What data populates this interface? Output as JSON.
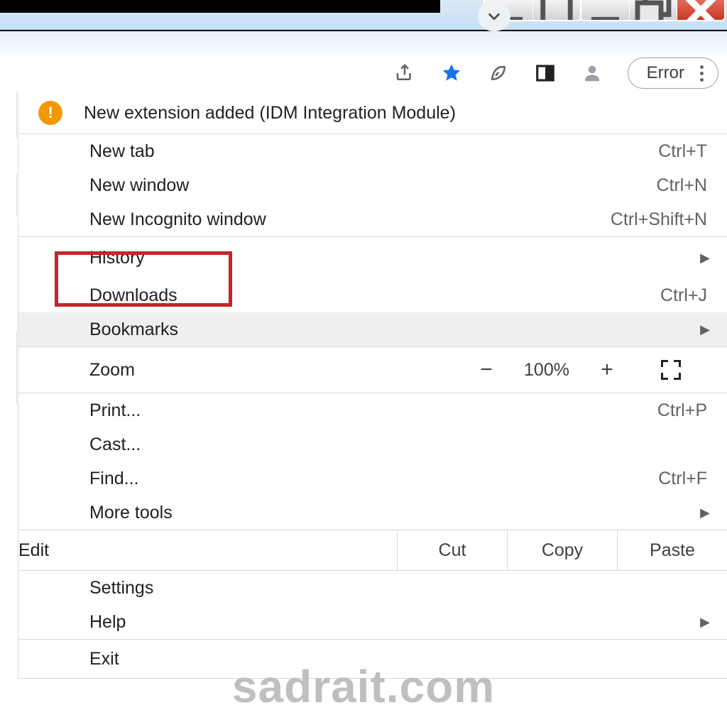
{
  "toolbar": {
    "error_label": "Error"
  },
  "notice": {
    "text": "New extension added (IDM Integration Module)"
  },
  "menu": {
    "new_tab": {
      "label": "New tab",
      "shortcut": "Ctrl+T"
    },
    "new_window": {
      "label": "New window",
      "shortcut": "Ctrl+N"
    },
    "new_incognito": {
      "label": "New Incognito window",
      "shortcut": "Ctrl+Shift+N"
    },
    "history": {
      "label": "History"
    },
    "downloads": {
      "label": "Downloads",
      "shortcut": "Ctrl+J"
    },
    "bookmarks": {
      "label": "Bookmarks"
    },
    "zoom": {
      "label": "Zoom",
      "value": "100%",
      "minus": "−",
      "plus": "+"
    },
    "print": {
      "label": "Print...",
      "shortcut": "Ctrl+P"
    },
    "cast": {
      "label": "Cast..."
    },
    "find": {
      "label": "Find...",
      "shortcut": "Ctrl+F"
    },
    "more_tools": {
      "label": "More tools"
    },
    "edit": {
      "label": "Edit",
      "cut": "Cut",
      "copy": "Copy",
      "paste": "Paste"
    },
    "settings": {
      "label": "Settings"
    },
    "help": {
      "label": "Help"
    },
    "exit": {
      "label": "Exit"
    }
  },
  "watermark": "sadrait.com"
}
